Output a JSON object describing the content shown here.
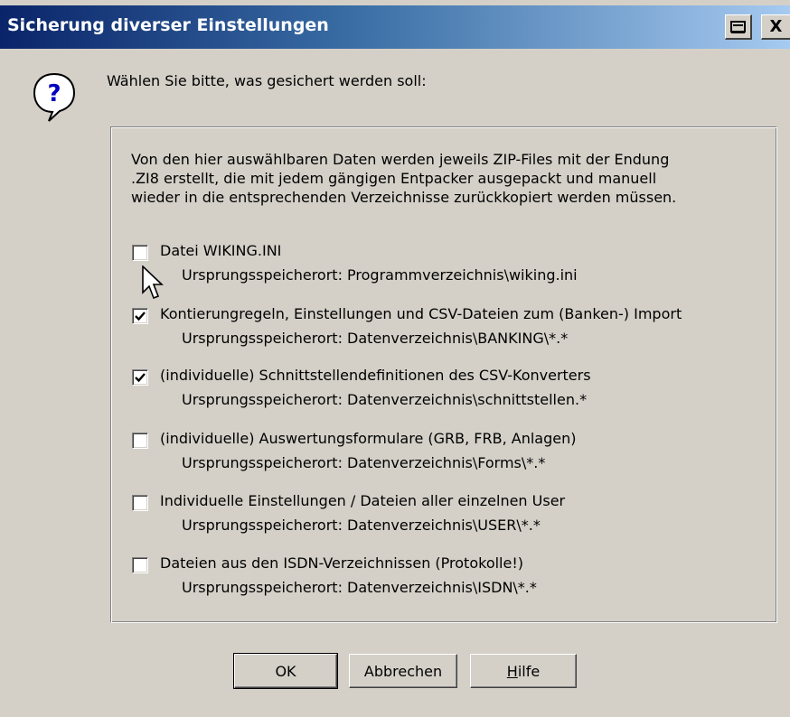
{
  "window": {
    "title": "Sicherung diverser Einstellungen",
    "help_button": "?",
    "close_button": "X"
  },
  "prompt": "Wählen Sie bitte, was gesichert werden soll:",
  "description": [
    "Von den hier auswählbaren Daten werden jeweils ZIP-Files mit der Endung",
    ".ZI8 erstellt, die mit jedem gängigen Entpacker ausgepackt und manuell",
    "wieder in die entsprechenden Verzeichnisse zurückkopiert werden müssen."
  ],
  "options": [
    {
      "label": "Datei WIKING.INI",
      "path": "Ursprungsspeicherort: Programmverzeichnis\\wiking.ini",
      "checked": false
    },
    {
      "label": "Kontierungregeln, Einstellungen und CSV-Dateien zum (Banken-) Import",
      "path": "Ursprungsspeicherort: Datenverzeichnis\\BANKING\\*.*",
      "checked": true
    },
    {
      "label": "(individuelle) Schnittstellendefinitionen des CSV-Konverters",
      "path": "Ursprungsspeicherort: Datenverzeichnis\\schnittstellen.*",
      "checked": true
    },
    {
      "label": "(individuelle) Auswertungsformulare (GRB, FRB, Anlagen)",
      "path": "Ursprungsspeicherort: Datenverzeichnis\\Forms\\*.*",
      "checked": false
    },
    {
      "label": "Individuelle Einstellungen / Dateien aller einzelnen User",
      "path": "Ursprungsspeicherort: Datenverzeichnis\\USER\\*.*",
      "checked": false
    },
    {
      "label": "Dateien aus den ISDN-Verzeichnissen (Protokolle!)",
      "path": "Ursprungsspeicherort: Datenverzeichnis\\ISDN\\*.*",
      "checked": false
    }
  ],
  "buttons": {
    "ok": "OK",
    "cancel": "Abbrechen",
    "help": "Hilfe"
  },
  "icons": {
    "dialog": "question-icon",
    "cursor": "mouse-pointer-icon"
  },
  "colors": {
    "title_gradient_start": "#0a246a",
    "title_gradient_end": "#a6caf0",
    "dialog_bg": "#d4d0c8"
  }
}
